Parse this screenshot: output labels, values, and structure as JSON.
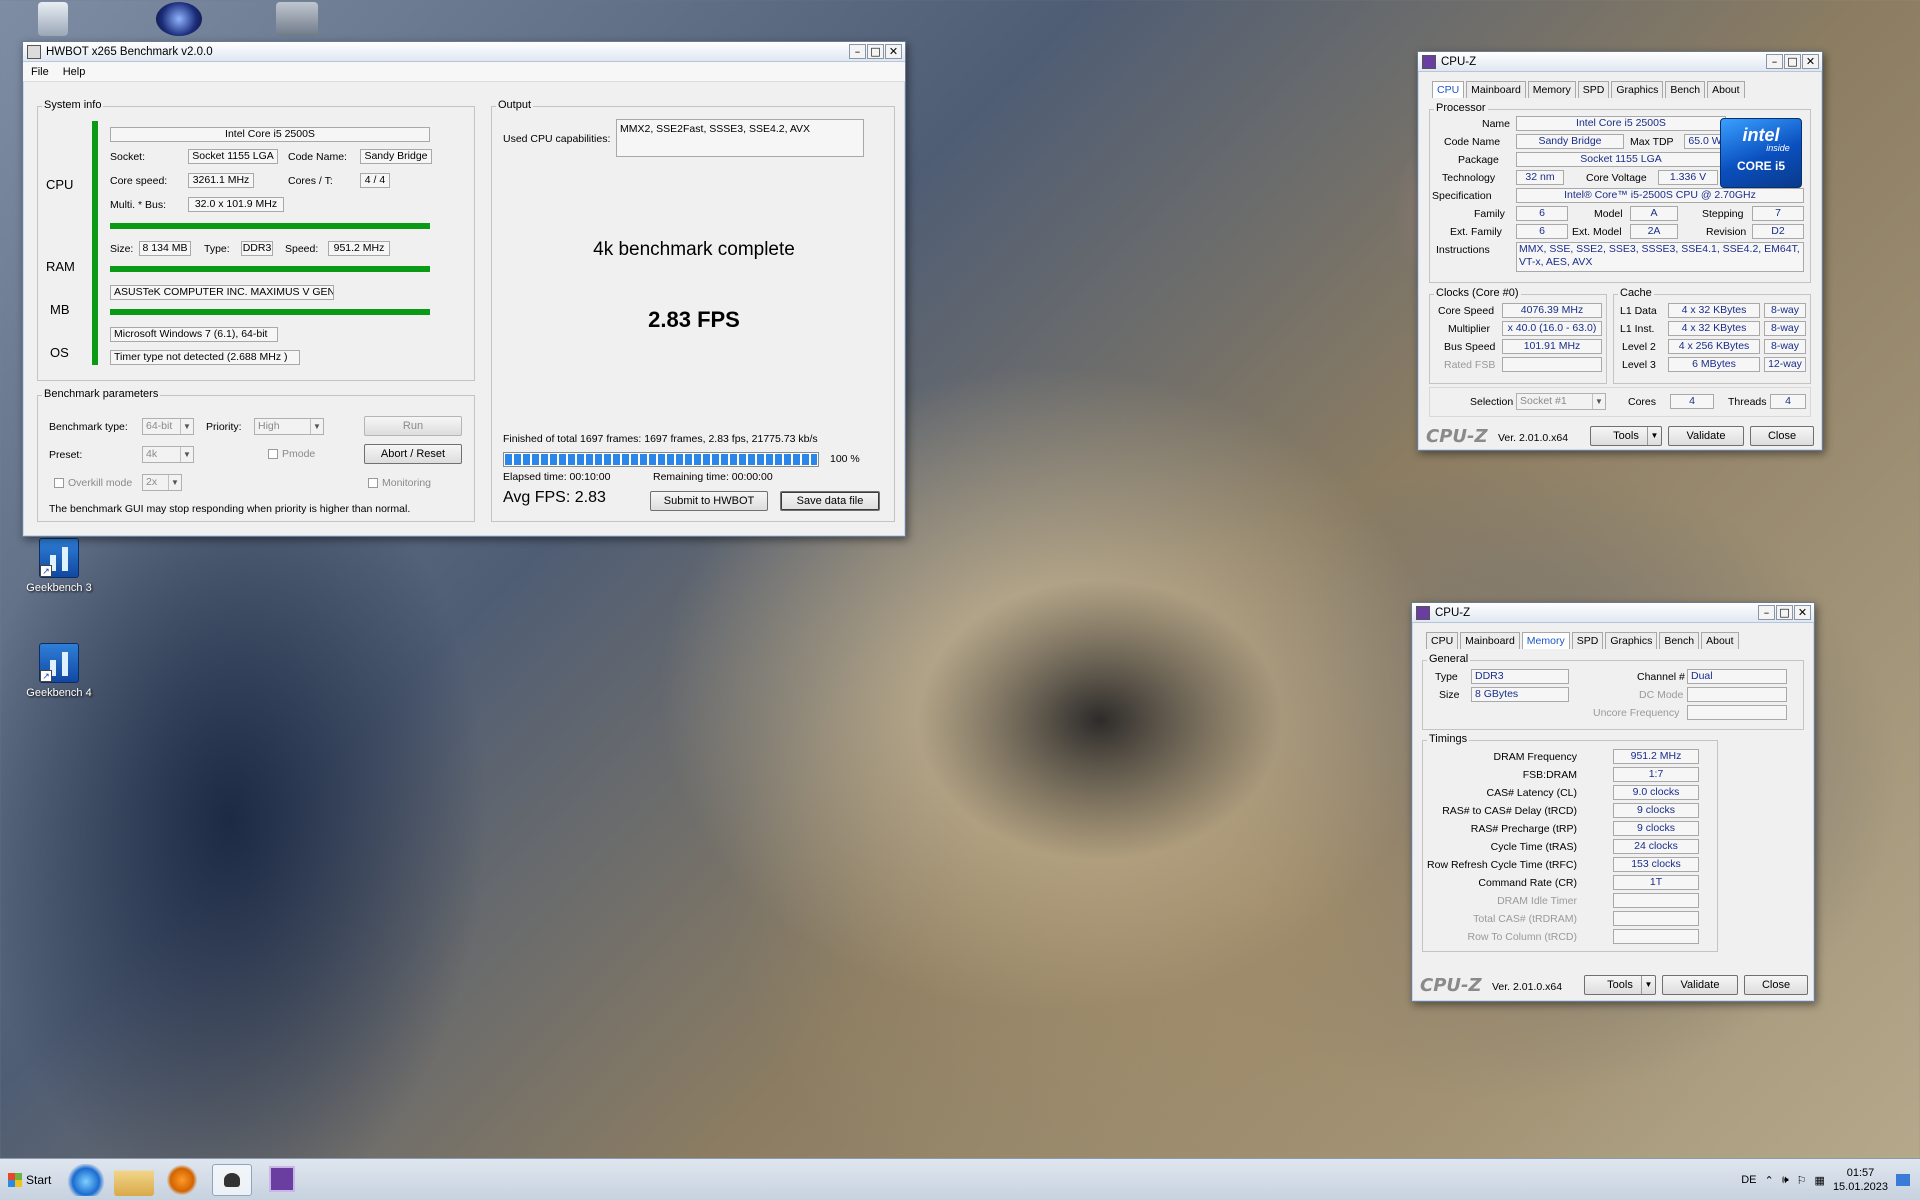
{
  "desktop": {
    "icons": [
      {
        "label": "Geekbench 3"
      },
      {
        "label": "Geekbench 4"
      }
    ]
  },
  "hwbot": {
    "title": "HWBOT x265 Benchmark v2.0.0",
    "menu": [
      "File",
      "Help"
    ],
    "system_info": {
      "legend": "System info",
      "cpu_label": "CPU",
      "ram_label": "RAM",
      "mb_label": "MB",
      "os_label": "OS",
      "cpu_name": "Intel Core i5 2500S",
      "socket_label": "Socket:",
      "socket": "Socket 1155 LGA",
      "codename_label": "Code Name:",
      "codename": "Sandy Bridge",
      "core_speed_label": "Core speed:",
      "core_speed": "3261.1 MHz",
      "cores_label": "Cores / T:",
      "cores": "4 / 4",
      "multi_label": "Multi. * Bus:",
      "multi": "32.0 x 101.9 MHz",
      "size_label": "Size:",
      "ram_size": "8 134 MB",
      "type_label": "Type:",
      "ram_type": "DDR3",
      "speed_label": "Speed:",
      "ram_speed": "951.2 MHz",
      "mb_name": "ASUSTeK COMPUTER INC. MAXIMUS V GENE",
      "os_name": "Microsoft Windows 7 (6.1), 64-bit",
      "timer": "Timer type not detected (2.688 MHz )"
    },
    "params": {
      "legend": "Benchmark parameters",
      "bench_type_label": "Benchmark type:",
      "bench_type": "64-bit",
      "priority_label": "Priority:",
      "priority": "High",
      "preset_label": "Preset:",
      "preset": "4k",
      "pmode_label": "Pmode",
      "overkill_label": "Overkill mode",
      "overkill": "2x",
      "monitoring_label": "Monitoring",
      "run_button": "Run",
      "abort_button": "Abort / Reset",
      "warning": "The benchmark GUI may stop responding when priority is higher than normal."
    },
    "output": {
      "legend": "Output",
      "caps_label": "Used CPU capabilities:",
      "caps": "MMX2, SSE2Fast, SSSE3, SSE4.2, AVX",
      "status": "4k benchmark complete",
      "fps": "2.83 FPS",
      "summary": "Finished of total 1697 frames: 1697 frames, 2.83 fps,  21775.73 kb/s",
      "progress_percent_text": "100 %",
      "progress": 1.0,
      "elapsed": "Elapsed time: 00:10:00",
      "remaining": "Remaining time: 00:00:00",
      "avg_fps": "Avg FPS: 2.83",
      "submit_button": "Submit to HWBOT",
      "save_button": "Save data file"
    }
  },
  "cpuz_cpu": {
    "title": "CPU-Z",
    "tabs": [
      "CPU",
      "Mainboard",
      "Memory",
      "SPD",
      "Graphics",
      "Bench",
      "About"
    ],
    "active_tab": "CPU",
    "processor_legend": "Processor",
    "name_label": "Name",
    "name": "Intel Core i5 2500S",
    "codename_label": "Code Name",
    "codename": "Sandy Bridge",
    "maxtdp_label": "Max TDP",
    "maxtdp": "65.0 W",
    "package_label": "Package",
    "package": "Socket 1155 LGA",
    "technology_label": "Technology",
    "technology": "32 nm",
    "corevoltage_label": "Core Voltage",
    "corevoltage": "1.336 V",
    "spec_label": "Specification",
    "spec": "Intel® Core™ i5-2500S CPU @ 2.70GHz",
    "family_label": "Family",
    "family": "6",
    "model_label": "Model",
    "model": "A",
    "stepping_label": "Stepping",
    "stepping": "7",
    "extfamily_label": "Ext. Family",
    "extfamily": "6",
    "extmodel_label": "Ext. Model",
    "extmodel": "2A",
    "revision_label": "Revision",
    "revision": "D2",
    "instructions_label": "Instructions",
    "instructions": "MMX, SSE, SSE2, SSE3, SSSE3, SSE4.1, SSE4.2, EM64T, VT-x, AES, AVX",
    "logo_brand": "intel",
    "logo_inside": "inside",
    "logo_core": "CORE i5",
    "clocks_legend": "Clocks (Core #0)",
    "corespeed_label": "Core Speed",
    "corespeed": "4076.39 MHz",
    "multiplier_label": "Multiplier",
    "multiplier": "x 40.0 (16.0 - 63.0)",
    "busspeed_label": "Bus Speed",
    "busspeed": "101.91 MHz",
    "ratedfsb_label": "Rated FSB",
    "cache_legend": "Cache",
    "l1data_label": "L1 Data",
    "l1data": "4 x 32 KBytes",
    "l1data_way": "8-way",
    "l1inst_label": "L1 Inst.",
    "l1inst": "4 x 32 KBytes",
    "l1inst_way": "8-way",
    "l2_label": "Level 2",
    "l2": "4 x 256 KBytes",
    "l2_way": "8-way",
    "l3_label": "Level 3",
    "l3": "6 MBytes",
    "l3_way": "12-way",
    "selection_label": "Selection",
    "selection": "Socket #1",
    "cores_label": "Cores",
    "cores": "4",
    "threads_label": "Threads",
    "threads": "4",
    "brand": "CPU-Z",
    "version": "Ver. 2.01.0.x64",
    "tools_button": "Tools",
    "validate_button": "Validate",
    "close_button": "Close"
  },
  "cpuz_mem": {
    "title": "CPU-Z",
    "tabs": [
      "CPU",
      "Mainboard",
      "Memory",
      "SPD",
      "Graphics",
      "Bench",
      "About"
    ],
    "active_tab": "Memory",
    "general_legend": "General",
    "type_label": "Type",
    "type": "DDR3",
    "size_label": "Size",
    "size": "8 GBytes",
    "channel_label": "Channel #",
    "channel": "Dual",
    "dcmode_label": "DC Mode",
    "uncore_label": "Uncore Frequency",
    "timings_legend": "Timings",
    "timings": [
      {
        "label": "DRAM Frequency",
        "value": "951.2 MHz"
      },
      {
        "label": "FSB:DRAM",
        "value": "1:7"
      },
      {
        "label": "CAS# Latency (CL)",
        "value": "9.0 clocks"
      },
      {
        "label": "RAS# to CAS# Delay (tRCD)",
        "value": "9 clocks"
      },
      {
        "label": "RAS# Precharge (tRP)",
        "value": "9 clocks"
      },
      {
        "label": "Cycle Time (tRAS)",
        "value": "24 clocks"
      },
      {
        "label": "Row Refresh Cycle Time (tRFC)",
        "value": "153 clocks"
      },
      {
        "label": "Command Rate (CR)",
        "value": "1T"
      },
      {
        "label": "DRAM Idle Timer",
        "value": ""
      },
      {
        "label": "Total CAS# (tRDRAM)",
        "value": ""
      },
      {
        "label": "Row To Column (tRCD)",
        "value": ""
      }
    ],
    "brand": "CPU-Z",
    "version": "Ver. 2.01.0.x64",
    "tools_button": "Tools",
    "validate_button": "Validate",
    "close_button": "Close"
  },
  "taskbar": {
    "start_label": "Start",
    "language": "DE",
    "time": "01:57",
    "date": "15.01.2023"
  }
}
